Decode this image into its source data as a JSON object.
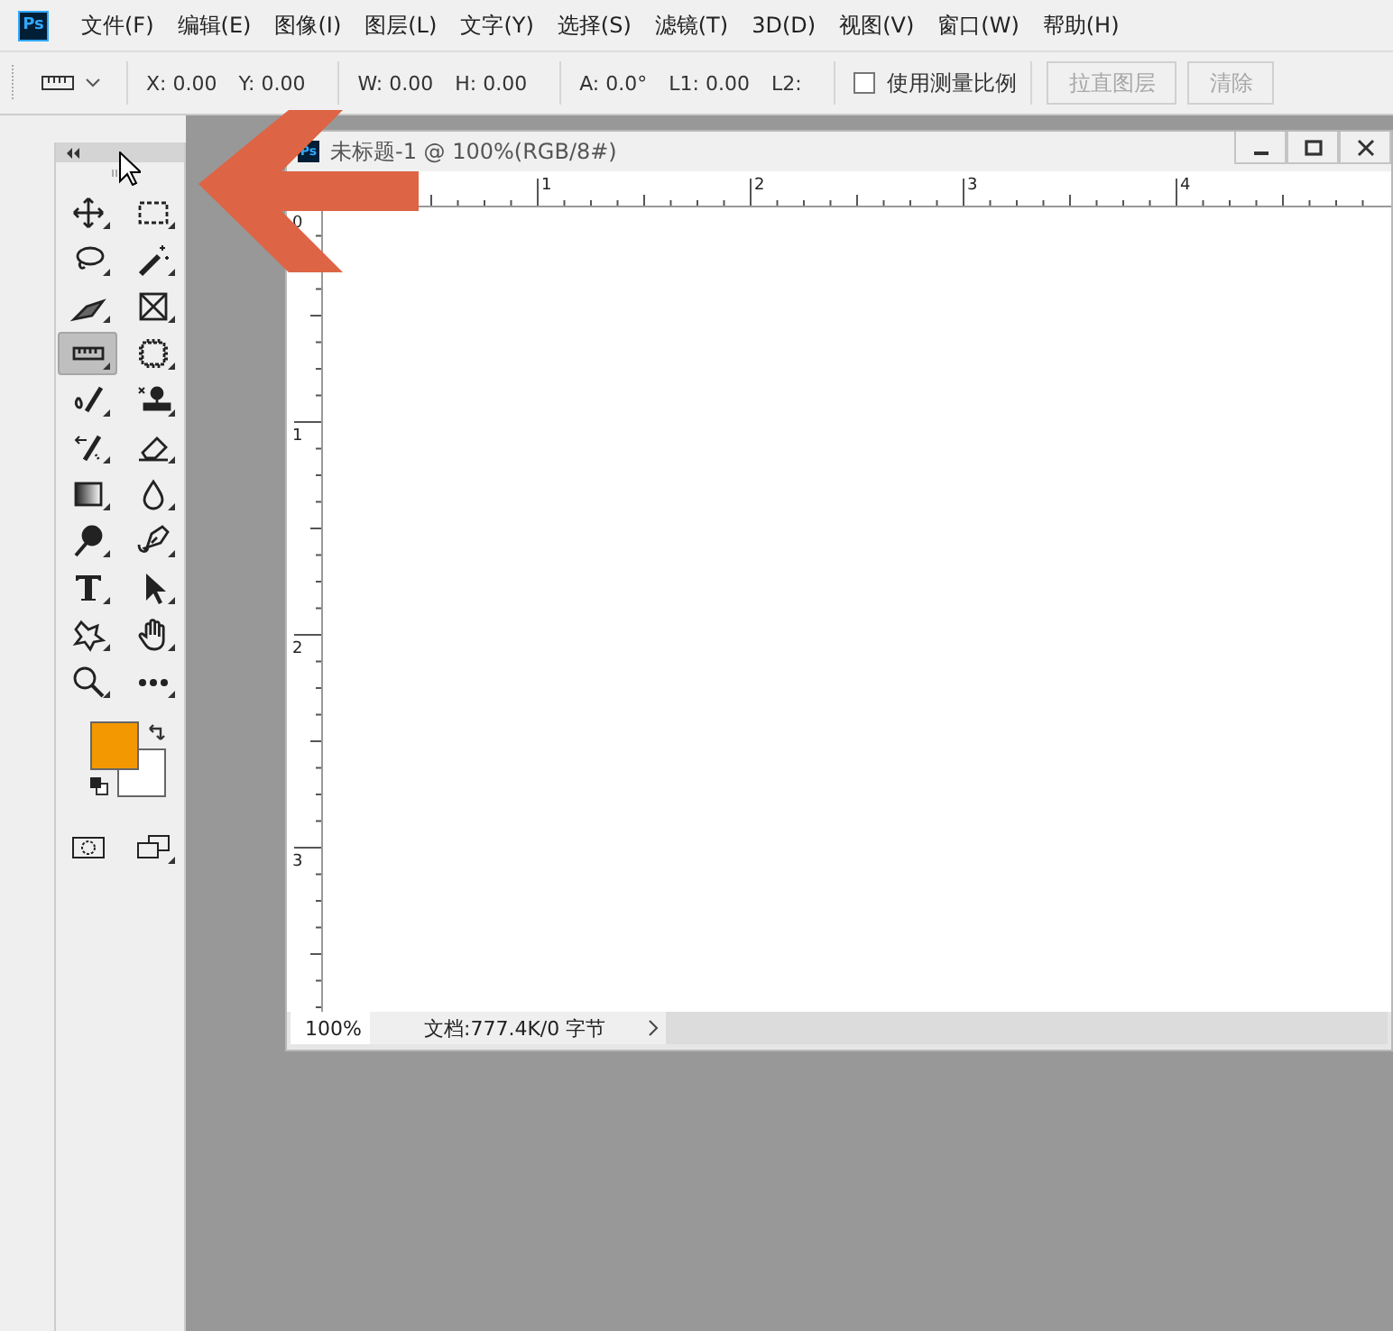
{
  "app_logo": "Ps",
  "menu": [
    "文件(F)",
    "编辑(E)",
    "图像(I)",
    "图层(L)",
    "文字(Y)",
    "选择(S)",
    "滤镜(T)",
    "3D(D)",
    "视图(V)",
    "窗口(W)",
    "帮助(H)"
  ],
  "options_bar": {
    "readouts": [
      "X: 0.00",
      "Y: 0.00",
      "W: 0.00",
      "H: 0.00",
      "A: 0.0°",
      "L1: 0.00",
      "L2:"
    ],
    "use_scale": {
      "label": "使用测量比例",
      "checked": false
    },
    "buttons": [
      {
        "label": "拉直图层",
        "disabled": true
      },
      {
        "label": "清除",
        "disabled": true
      }
    ]
  },
  "toolbar": {
    "tools": [
      {
        "selected": false
      },
      {
        "selected": false
      },
      {
        "selected": false
      },
      {
        "selected": false
      },
      {
        "selected": false
      },
      {
        "selected": false
      },
      {
        "selected": true
      },
      {
        "selected": false
      },
      {
        "selected": false
      },
      {
        "selected": false
      },
      {
        "selected": false
      },
      {
        "selected": false
      },
      {
        "selected": false
      },
      {
        "selected": false
      },
      {
        "selected": false
      },
      {
        "selected": false
      },
      {
        "selected": false
      },
      {
        "selected": false
      },
      {
        "selected": false
      },
      {
        "selected": false
      },
      {
        "selected": false
      },
      {
        "selected": false
      }
    ]
  },
  "document": {
    "icon": "Ps",
    "title": "未标题-1 @ 100%(RGB/8#)",
    "rulers": {
      "horizontal": [
        "1",
        "2",
        "3",
        "4"
      ],
      "vertical": [
        "0",
        "1",
        "2",
        "3"
      ]
    },
    "status": {
      "zoom": "100%",
      "info": "文档:777.4K/0 字节"
    }
  }
}
